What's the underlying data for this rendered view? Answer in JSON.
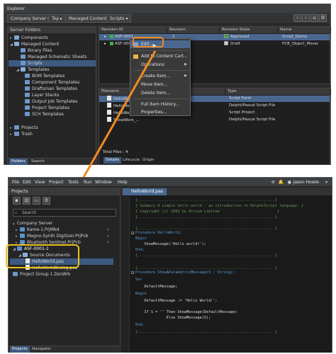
{
  "colors": {
    "accent_orange": "#f08a24",
    "accent_yellow": "#e8c21c",
    "selection": "#4a6790",
    "state_approved": "#2e9e3a",
    "state_draft": "#cfcfcf"
  },
  "explorer": {
    "title": "Explorer",
    "breadcrumb": [
      "Company Server",
      "Top",
      "Managed Content",
      "Scripts"
    ],
    "toolbar_icons": [
      "back-icon",
      "forward-icon",
      "home-icon",
      "settings-icon"
    ],
    "folders_header": "Server Folders",
    "folders": [
      "Components",
      "Managed Content",
      "Binary Files",
      "Managed Schematic Sheets",
      "Scripts",
      "Templates",
      "BOM Templates",
      "Component Templates",
      "Draftsman Templates",
      "Layer Stacks",
      "Output Job Templates",
      "Project Templates",
      "SCH Templates",
      "Projects",
      "Trash"
    ],
    "left_tabs": [
      "Folders",
      "Search"
    ],
    "items_columns": [
      "Revision ID",
      "Revision",
      "Revision State",
      "Name"
    ],
    "items": [
      {
        "id": "ASF-0001",
        "revision": "1",
        "state": "Approved",
        "name": "Script_Demo"
      },
      {
        "id": "ASF-0002",
        "revision": "",
        "state": "Draft",
        "name": "PCB_Object_Mover"
      }
    ],
    "files_columns": [
      "Filename",
      "Type"
    ],
    "files": [
      {
        "name": "HelloWor...",
        "type": "Script Form"
      },
      {
        "name": "HelloWor...",
        "type": "Delphi/Pascal Script File"
      },
      {
        "name": "HelloWor...",
        "type": "Script Project"
      },
      {
        "name": "ShowWork_...",
        "type": "Delphi/Pascal Script File"
      }
    ],
    "total_files": "Total Files : 4",
    "bottom_tabs": [
      "Details",
      "Lifecycle",
      "Origin"
    ]
  },
  "context_menu": {
    "items": [
      "Edit...",
      "Add to Content Cart...",
      "Operations",
      "Create Item...",
      "Move Item...",
      "Delete Item...",
      "Full Item History...",
      "Properties..."
    ]
  },
  "editor": {
    "menu": [
      "File",
      "Edit",
      "View",
      "Project",
      "Tools",
      "Run",
      "Window",
      "Help"
    ],
    "user": "Jason Howie",
    "projects_title": "Projects",
    "search_placeholder": "Search",
    "tree": [
      "Company Server",
      "Kame-1.PrjMbd",
      "Magno-Synth Digitizer.PrjPcb",
      "Bluetooth Sentinel.PrjPcb",
      "ASF-0001-1",
      "Source Documents",
      "HelloWorld.pas",
      "HelloWorldDialog.pas",
      "Project Group 1.DsnWrk"
    ],
    "doc_tab": "HelloWorld.pas",
    "bottom_tabs": [
      "Projects",
      "Navigator"
    ],
    "code": [
      "{..............................................................}",
      "{ Summary A simple hello world - an introduction to DelphiScript language. }",
      "{ Copyright (c) 2003 by Altium Limited                          }",
      "{..............................................................}",
      "",
      "{..............................................................}",
      "Procedure HelloWorld;",
      "Begin",
      "    ShowMessage('Hello world!');",
      "End;",
      "{..............................................................}",
      "",
      "{..............................................................}",
      "Procedure ShowAParametricMessage(S : String);",
      "Var",
      "    DefaultMessage;",
      "Begin",
      "    DefaultMessage := 'Hello World!';",
      "",
      "    If S = '' Then ShowMessage(DefaultMessage)",
      "              Else ShowMessage(S);",
      "End;",
      "{..............................................................}"
    ]
  }
}
